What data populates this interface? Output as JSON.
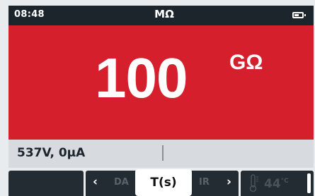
{
  "statusbar": {
    "time": "08:48",
    "mode_unit": "MΩ",
    "battery_icon": "battery-icon",
    "battery_level": 0.6
  },
  "reading": {
    "value": "100",
    "unit": "GΩ"
  },
  "info": {
    "text": "537V, 0μA"
  },
  "softkeys": {
    "selector": {
      "left_icon": "chevron-left-icon",
      "right_icon": "chevron-right-icon",
      "prev_option": "DA",
      "selected_option": "T(s)",
      "next_option": "IR"
    },
    "temperature": {
      "icon": "thermometer-icon",
      "value": "44",
      "unit": "°C"
    }
  },
  "colors": {
    "accent_red": "#d51f2d",
    "dark_bar": "#1d252c",
    "info_bg": "#d7dbdf"
  }
}
